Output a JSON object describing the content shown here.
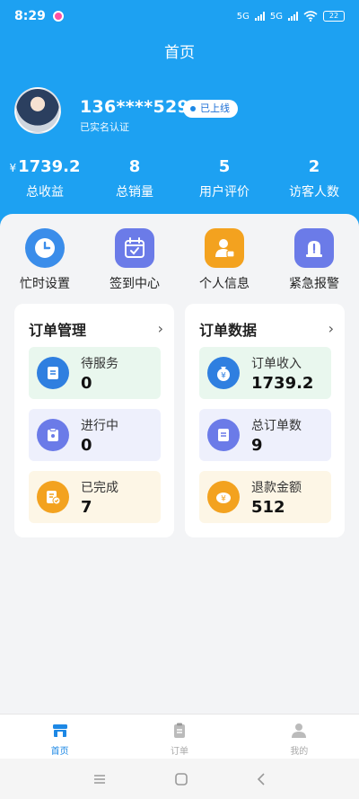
{
  "status_bar": {
    "time": "8:29",
    "signal_1": "5G",
    "signal_2": "5G",
    "battery": "22"
  },
  "header": {
    "title": "首页"
  },
  "profile": {
    "phone": "136****5297",
    "online_badge": "已上线",
    "verified": "已实名认证"
  },
  "stats": [
    {
      "currency": "¥",
      "value": "1739.2",
      "label": "总收益"
    },
    {
      "value": "8",
      "label": "总销量"
    },
    {
      "value": "5",
      "label": "用户评价"
    },
    {
      "value": "2",
      "label": "访客人数"
    }
  ],
  "quick_actions": [
    {
      "label": "忙时设置",
      "icon": "clock-icon",
      "color": "#3a8dea"
    },
    {
      "label": "签到中心",
      "icon": "calendar-check-icon",
      "color": "#6b7be8"
    },
    {
      "label": "个人信息",
      "icon": "person-card-icon",
      "color": "#f3a21f"
    },
    {
      "label": "紧急报警",
      "icon": "alarm-icon",
      "color": "#6b7be8"
    }
  ],
  "order_management": {
    "title": "订单管理",
    "items": [
      {
        "label": "待服务",
        "value": "0",
        "icon": "document-icon"
      },
      {
        "label": "进行中",
        "value": "0",
        "icon": "clipboard-icon"
      },
      {
        "label": "已完成",
        "value": "7",
        "icon": "document-check-icon"
      }
    ]
  },
  "order_data": {
    "title": "订单数据",
    "items": [
      {
        "label": "订单收入",
        "value": "1739.2",
        "icon": "money-bag-icon"
      },
      {
        "label": "总订单数",
        "value": "9",
        "icon": "list-icon"
      },
      {
        "label": "退款金额",
        "value": "512",
        "icon": "yen-icon"
      }
    ]
  },
  "tabbar": [
    {
      "label": "首页",
      "icon": "store-icon",
      "active": true
    },
    {
      "label": "订单",
      "icon": "clipboard-icon",
      "active": false
    },
    {
      "label": "我的",
      "icon": "user-icon",
      "active": false
    }
  ],
  "colors": {
    "primary": "#1da1f2",
    "active_tab": "#1d88e5",
    "green_tint": "#e9f7ee",
    "blue_tint": "#eef0fc",
    "yellow_tint": "#fdf6e6"
  }
}
